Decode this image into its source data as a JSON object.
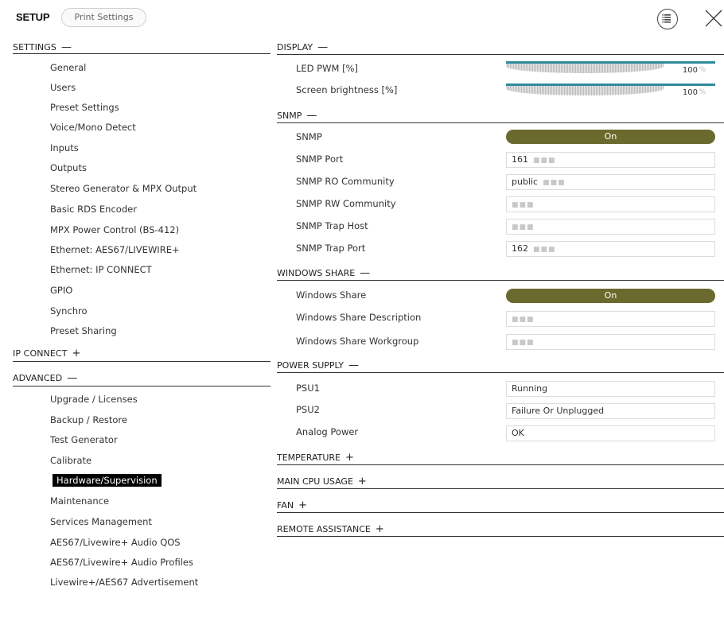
{
  "header": {
    "brand": "SETUP",
    "print_settings": "Print Settings"
  },
  "sidebar": {
    "sections": [
      {
        "title": "SETTINGS",
        "symbol": "—",
        "items": [
          "General",
          "Users",
          "Preset Settings",
          "Voice/Mono Detect",
          "Inputs",
          "Outputs",
          "Stereo Generator & MPX Output",
          "Basic RDS Encoder",
          "MPX Power Control (BS-412)",
          "Ethernet: AES67/LIVEWIRE+",
          "Ethernet: IP CONNECT",
          "GPIO",
          "Synchro",
          "Preset Sharing"
        ]
      },
      {
        "title": "IP CONNECT",
        "symbol": "+"
      },
      {
        "title": "ADVANCED",
        "symbol": "—",
        "items": [
          "Upgrade / Licenses",
          "Backup / Restore",
          "Test Generator",
          "Calibrate",
          "Hardware/Supervision",
          "Maintenance",
          "Services Management",
          "AES67/Livewire+ Audio QOS",
          "AES67/Livewire+ Audio Profiles",
          "Livewire+/AES67 Advertisement"
        ]
      }
    ],
    "active_item": "Hardware/Supervision"
  },
  "main": {
    "display": {
      "title": "DISPLAY",
      "symbol": "—",
      "led_pwm_label": "LED PWM [%]",
      "led_pwm_value": "100",
      "led_pwm_unit": "%",
      "screen_brightness_label": "Screen brightness [%]",
      "screen_brightness_value": "100",
      "screen_brightness_unit": "%"
    },
    "snmp": {
      "title": "SNMP",
      "symbol": "—",
      "snmp_label": "SNMP",
      "snmp_state": "On",
      "port_label": "SNMP Port",
      "port_value": "161",
      "ro_label": "SNMP RO Community",
      "ro_value": "public",
      "rw_label": "SNMP RW Community",
      "rw_value": "",
      "trap_host_label": "SNMP Trap Host",
      "trap_host_value": "",
      "trap_port_label": "SNMP Trap Port",
      "trap_port_value": "162"
    },
    "windows_share": {
      "title": "WINDOWS SHARE",
      "symbol": "—",
      "share_label": "Windows Share",
      "share_state": "On",
      "desc_label": "Windows Share Description",
      "desc_value": "",
      "workgroup_label": "Windows Share Workgroup",
      "workgroup_value": ""
    },
    "power_supply": {
      "title": "POWER SUPPLY",
      "symbol": "—",
      "psu1_label": "PSU1",
      "psu1_value": "Running",
      "psu2_label": "PSU2",
      "psu2_value": "Failure Or Unplugged",
      "analog_label": "Analog Power",
      "analog_value": "OK"
    },
    "collapsed_groups": [
      {
        "title": "TEMPERATURE",
        "symbol": "+"
      },
      {
        "title": "MAIN CPU USAGE",
        "symbol": "+"
      },
      {
        "title": "FAN",
        "symbol": "+"
      },
      {
        "title": "REMOTE ASSISTANCE",
        "symbol": "+"
      }
    ]
  },
  "colors": {
    "toggle_on": "#6b6a2e",
    "slider_track": "#2f8a9c",
    "active_item_bg": "#000000"
  },
  "icons": [
    "list-circle-icon",
    "close-icon"
  ]
}
